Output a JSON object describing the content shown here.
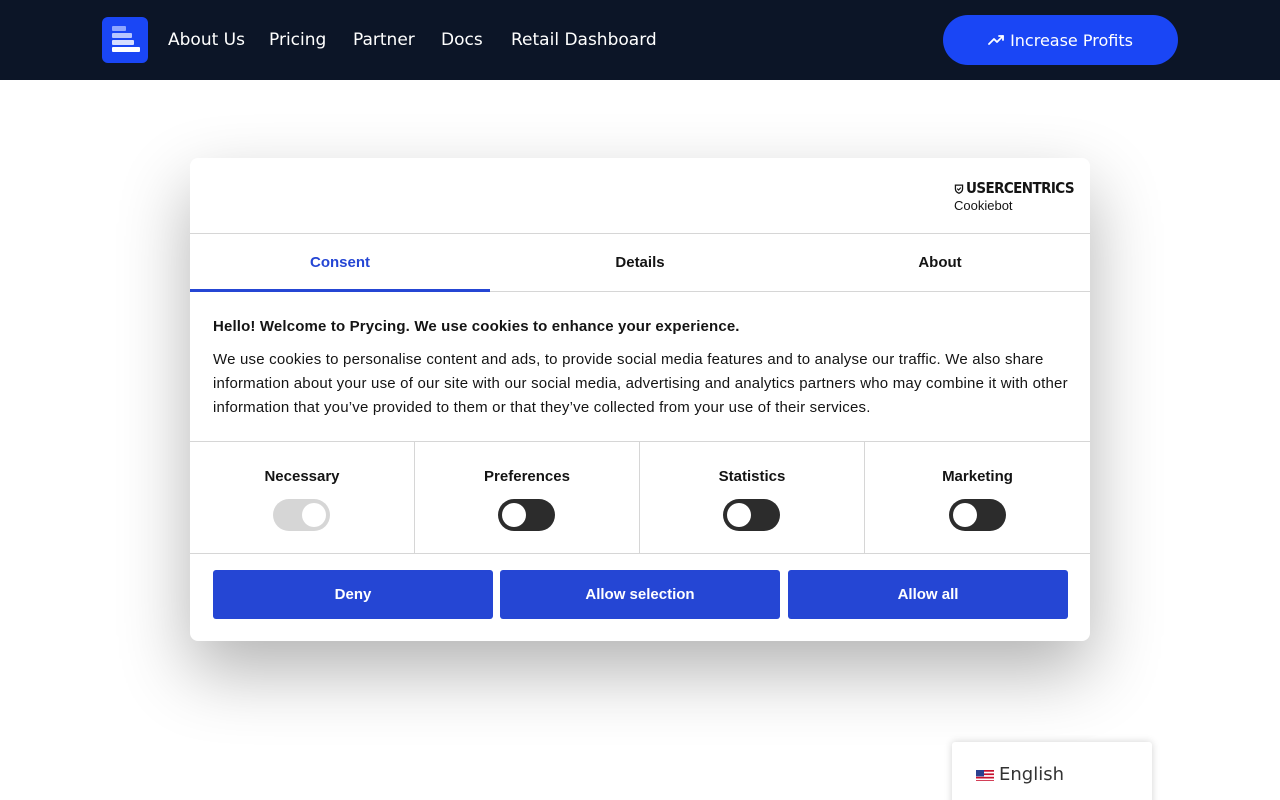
{
  "nav": {
    "links": [
      "About Us",
      "Pricing",
      "Partner",
      "Docs",
      "Retail Dashboard"
    ],
    "cta_label": "Increase Profits",
    "cta_icon": "trending-up-icon",
    "logo_icon": "bars-logo-icon",
    "background": "#0c1527",
    "accent": "#1a46f5"
  },
  "consent": {
    "brand_top": "USERCENTRICS",
    "brand_bottom": "Cookiebot",
    "tabs": [
      "Consent",
      "Details",
      "About"
    ],
    "active_tab": "Consent",
    "title": "Hello! Welcome to Prycing. We use cookies to enhance your experience.",
    "body": "We use cookies to personalise content and ads, to provide social media features and to analyse our traffic. We also share information about your use of our site with our social media, advertising and analytics partners who may combine it with other information that you’ve provided to them or that they’ve collected from your use of their services.",
    "categories": [
      {
        "label": "Necessary",
        "enabled": true,
        "disabled": true
      },
      {
        "label": "Preferences",
        "enabled": false,
        "disabled": false
      },
      {
        "label": "Statistics",
        "enabled": false,
        "disabled": false
      },
      {
        "label": "Marketing",
        "enabled": false,
        "disabled": false
      }
    ],
    "buttons": {
      "deny": "Deny",
      "allow_selection": "Allow selection",
      "allow_all": "Allow all"
    },
    "accent": "#2546d4"
  },
  "language": {
    "current": "English",
    "flag_icon": "us-flag-icon"
  }
}
